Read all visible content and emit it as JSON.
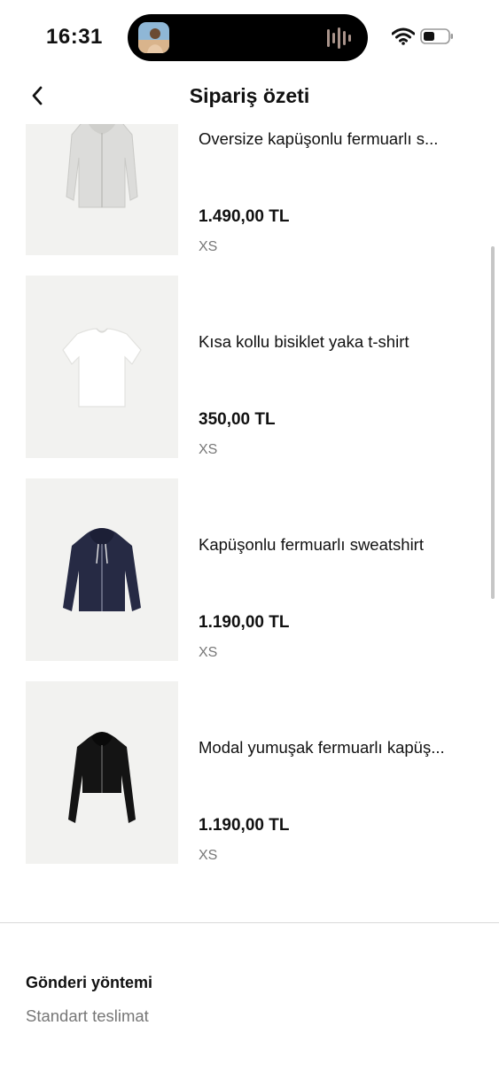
{
  "status_bar": {
    "time": "16:31",
    "icons": [
      "dynamic-island-album-art",
      "audio-wave-icon",
      "wifi-icon",
      "battery-icon"
    ]
  },
  "header": {
    "title": "Sipariş özeti",
    "back_icon": "chevron-left-icon"
  },
  "items": [
    {
      "name": "Oversize kapüşonlu fermuarlı s...",
      "price": "1.490,00 TL",
      "size": "XS",
      "image": "light-grey-zip-hoodie"
    },
    {
      "name": "Kısa kollu bisiklet yaka t-shirt",
      "price": "350,00 TL",
      "size": "XS",
      "image": "white-tshirt"
    },
    {
      "name": "Kapüşonlu fermuarlı sweatshirt",
      "price": "1.190,00 TL",
      "size": "XS",
      "image": "navy-zip-hoodie"
    },
    {
      "name": "Modal yumuşak fermuarlı kapüş...",
      "price": "1.190,00 TL",
      "size": "XS",
      "image": "black-zip-hoodie"
    }
  ],
  "shipping": {
    "title": "Gönderi yöntemi",
    "value": "Standart teslimat"
  },
  "colors": {
    "background": "#ffffff",
    "text": "#111111",
    "muted": "#777777",
    "thumbnail_bg": "#f2f2f0",
    "divider": "#d9d9d9"
  }
}
